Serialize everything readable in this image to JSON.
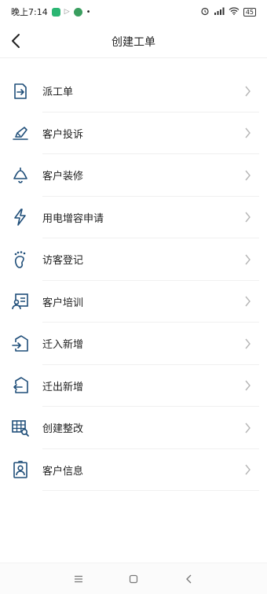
{
  "status_bar": {
    "time": "晚上7:14",
    "battery": "45",
    "notification_colors": [
      "#2bb673",
      "#9b59b6",
      "#3a9e5f"
    ]
  },
  "header": {
    "title": "创建工单",
    "back_icon": "chevron-left-icon"
  },
  "menu": {
    "items": [
      {
        "label": "派工单",
        "icon": "dispatch-icon"
      },
      {
        "label": "客户投诉",
        "icon": "complaint-pen-icon"
      },
      {
        "label": "客户装修",
        "icon": "ceiling-lamp-icon"
      },
      {
        "label": "用电增容申请",
        "icon": "lightning-icon"
      },
      {
        "label": "访客登记",
        "icon": "footprint-icon"
      },
      {
        "label": "客户培训",
        "icon": "training-icon"
      },
      {
        "label": "迁入新增",
        "icon": "move-in-icon"
      },
      {
        "label": "迁出新增",
        "icon": "move-out-icon"
      },
      {
        "label": "创建整改",
        "icon": "grid-search-icon"
      },
      {
        "label": "客户信息",
        "icon": "id-badge-icon"
      }
    ]
  },
  "colors": {
    "icon": "#1f4e79",
    "chevron": "#b5b5b5",
    "divider": "#f0f0f0"
  }
}
